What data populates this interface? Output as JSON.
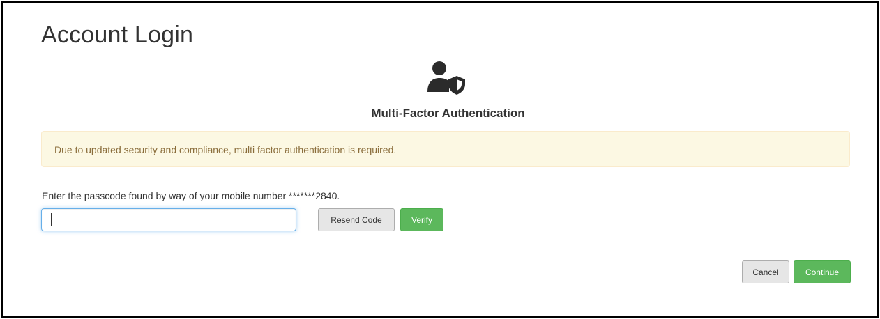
{
  "page": {
    "title": "Account Login"
  },
  "mfa": {
    "icon": "user-shield-icon",
    "heading": "Multi-Factor Authentication"
  },
  "alert": {
    "message": "Due to updated security and compliance, multi factor authentication is required."
  },
  "form": {
    "instruction": "Enter the passcode found by way of your mobile number *******2840.",
    "passcode_value": "",
    "resend_label": "Resend Code",
    "verify_label": "Verify"
  },
  "actions": {
    "cancel_label": "Cancel",
    "continue_label": "Continue"
  },
  "colors": {
    "success": "#5cb85c",
    "alert_background": "#fcf8e3",
    "alert_text": "#8a6d3b",
    "input_focus_border": "#66afe9"
  }
}
